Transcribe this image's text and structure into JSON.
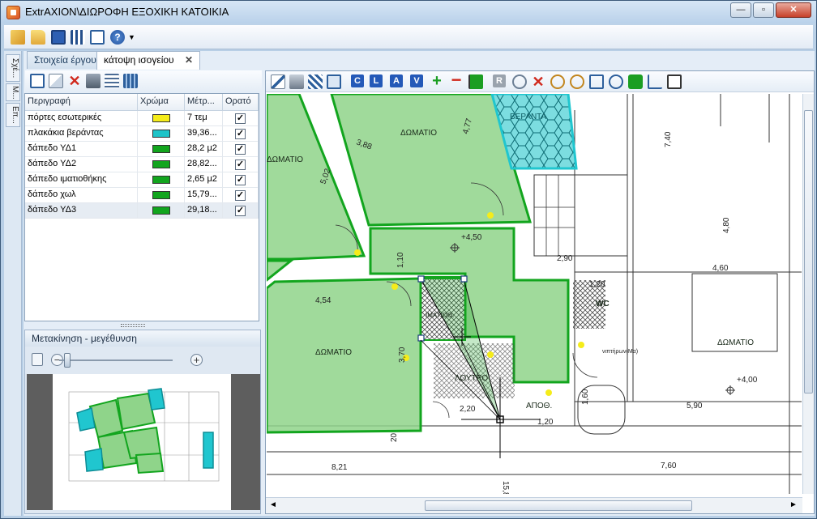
{
  "window": {
    "title": "ExtrAXION\\ΔΙΩΡΟΦΗ ΕΞΟΧΙΚΗ ΚΑΤΟΙΚΙΑ",
    "minimize_label": "—",
    "maximize_label": "▫",
    "close_label": "✕"
  },
  "side_tabs": [
    "Σχέ...",
    "Μ...",
    "Επ..."
  ],
  "tabs": [
    {
      "label": "Στοιχεία έργου"
    },
    {
      "label": "κάτοψη ισογείου",
      "close": "✕"
    }
  ],
  "table": {
    "headers": [
      "Περιγραφή",
      "Χρώμα",
      "Μέτρ...",
      "Ορατό"
    ],
    "rows": [
      {
        "desc": "πόρτες εσωτερικές",
        "color": "#f5ec1a",
        "measure": "7 τεμ",
        "visible": "✓"
      },
      {
        "desc": "πλακάκια βεράντας",
        "color": "#1ec4c8",
        "measure": "39,36...",
        "visible": "✓"
      },
      {
        "desc": "δάπεδο ΥΔ1",
        "color": "#12a51e",
        "measure": "28,2 μ2",
        "visible": "✓"
      },
      {
        "desc": "δάπεδο ΥΔ2",
        "color": "#12a51e",
        "measure": "28,82...",
        "visible": "✓"
      },
      {
        "desc": "δάπεδο ιματιοθήκης",
        "color": "#12a51e",
        "measure": "2,65 μ2",
        "visible": "✓"
      },
      {
        "desc": "δάπεδο χωλ",
        "color": "#12a51e",
        "measure": "15,79...",
        "visible": "✓"
      },
      {
        "desc": "δάπεδο ΥΔ3",
        "color": "#12a51e",
        "measure": "29,18...",
        "visible": "✓"
      }
    ]
  },
  "nav_panel": {
    "title": "Μετακίνηση - μεγέθυνση",
    "zoom_out": "−",
    "zoom_in": "+",
    "zoom_level": 0.07
  },
  "canvas_toolbar": {
    "letters": [
      "C",
      "L",
      "A",
      "V"
    ]
  },
  "drawing": {
    "rooms": [
      "ΔΩΜΑΤΙΟ",
      "ΔΩΜΑΤΙΟ",
      "ΔΩΜΑΤΙΟ",
      "ΔΩΜΑΤΙΟ",
      "ΒΕΡΑΝΤΑ",
      "WC",
      "ΑΠΟΘ.",
      "ΛΟΥΤΡΟ",
      "ΙΜΑΤΙΟΘ."
    ],
    "dims": [
      "4,77",
      "3,88",
      "5,02",
      "1,10",
      "4,54",
      "3,70",
      "2,20",
      "1,20",
      "8,21",
      "15,81",
      "7,40",
      "4,80",
      "2,90",
      "4,60",
      "1,20",
      "5,90",
      "7,60",
      "1,60",
      "+4,50",
      "+4,00",
      "20"
    ],
    "note": "νιπτήρων(Μα)"
  },
  "colors": {
    "accent": "#12a51e",
    "fill": "#8fd48a",
    "veranda": "#20c6cf"
  }
}
